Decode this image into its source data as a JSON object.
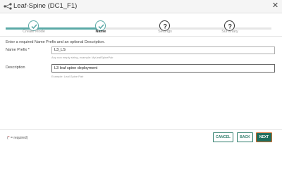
{
  "window": {
    "title": "Leaf-Spine (DC1_F1)",
    "title_icon": "topology-icon",
    "close_icon": "close-icon"
  },
  "wizard": {
    "steps": [
      {
        "label": "Create Mode",
        "status": "done"
      },
      {
        "label": "Name",
        "status": "done",
        "active": true
      },
      {
        "label": "Settings",
        "status": "pending"
      },
      {
        "label": "Summary",
        "status": "pending"
      }
    ]
  },
  "form": {
    "intro": "Enter a required Name Prefix and an optional Description.",
    "name_prefix": {
      "label": "Name Prefix *",
      "value": "L3_LS",
      "helper": "Any non empty string, example: MyLeafSpinePair"
    },
    "description": {
      "label": "Description",
      "value": "L3 leaf spine deployment",
      "helper": "Example: Leaf-Spine Pair"
    }
  },
  "footer": {
    "required_note_star": "*",
    "required_note_text": " = required)",
    "required_note_open": "(",
    "cancel_label": "CANCEL",
    "back_label": "BACK",
    "next_label": "NEXT"
  },
  "colors": {
    "accent": "#5aa9a6",
    "primary": "#1f6e5d",
    "focus": "#d36a2b",
    "required": "#c62828"
  }
}
